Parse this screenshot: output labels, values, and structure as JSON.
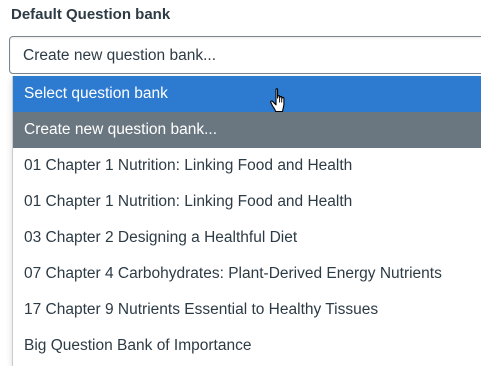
{
  "field": {
    "label": "Default Question bank",
    "value": "Create new question bank..."
  },
  "dropdown": {
    "options": [
      {
        "label": "Select question bank",
        "state": "hover"
      },
      {
        "label": "Create new question bank...",
        "state": "selected"
      },
      {
        "label": "01 Chapter 1 Nutrition: Linking Food and Health",
        "state": "normal"
      },
      {
        "label": "01 Chapter 1 Nutrition: Linking Food and Health",
        "state": "normal"
      },
      {
        "label": "03 Chapter 2 Designing a Healthful Diet",
        "state": "normal"
      },
      {
        "label": "07 Chapter 4 Carbohydrates: Plant-Derived Energy Nutrients",
        "state": "normal"
      },
      {
        "label": "17 Chapter 9 Nutrients Essential to Healthy Tissues",
        "state": "normal"
      },
      {
        "label": "Big Question Bank of Importance",
        "state": "normal"
      }
    ]
  },
  "cursor": {
    "icon": "hand-pointer-icon"
  },
  "colors": {
    "hover": "#2d7bd0",
    "selected": "#6b7780",
    "text": "#2d3b45"
  }
}
